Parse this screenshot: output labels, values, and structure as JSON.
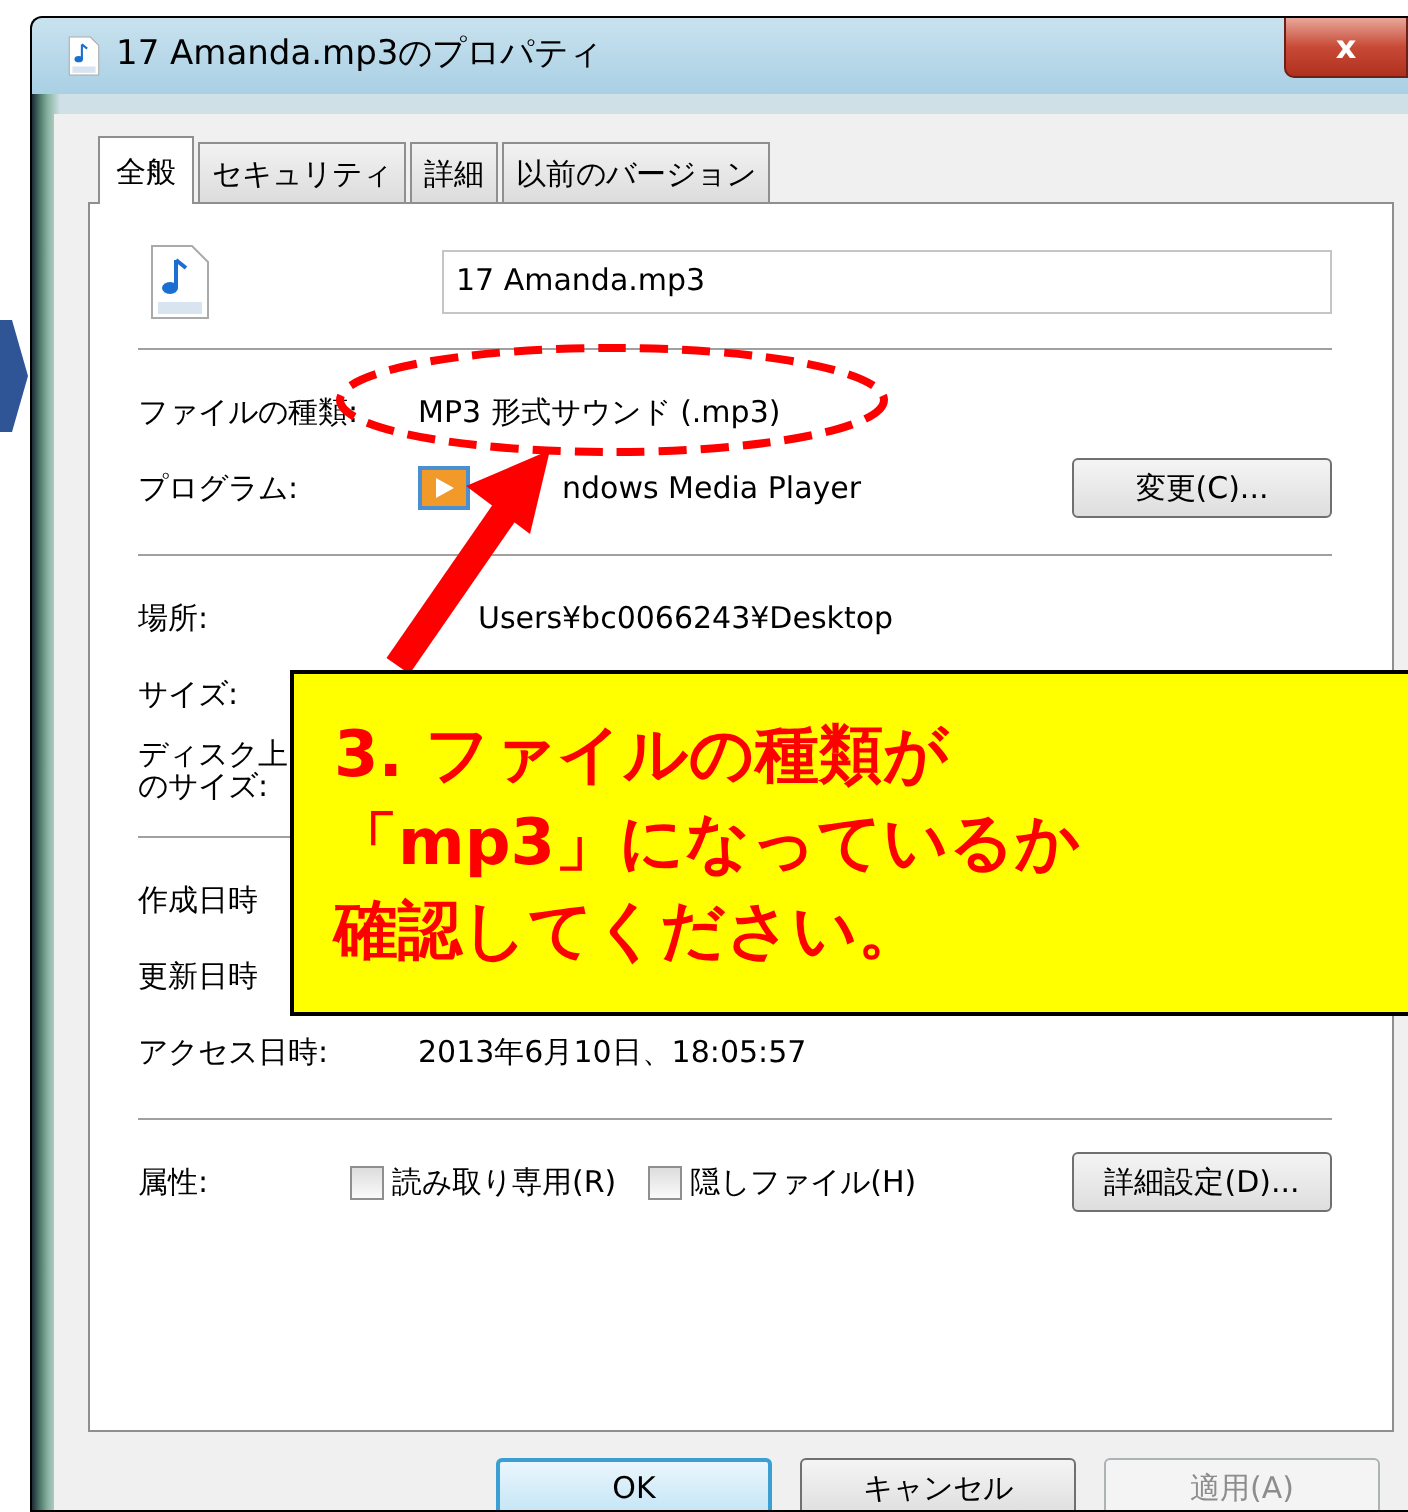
{
  "window": {
    "title": "17 Amanda.mp3のプロパティ",
    "close": "x"
  },
  "tabs": [
    {
      "label": "全般",
      "selected": true
    },
    {
      "label": "セキュリティ",
      "selected": false
    },
    {
      "label": "詳細",
      "selected": false
    },
    {
      "label": "以前のバージョン",
      "selected": false
    }
  ],
  "file_name": "17 Amanda.mp3",
  "sections": [
    [
      {
        "kind": "text",
        "label": "ファイルの種類:",
        "value": "MP3 形式サウンド (.mp3)"
      },
      {
        "kind": "program",
        "label": "プログラム:",
        "value": "ndows Media Player",
        "button": "変更(C)..."
      }
    ],
    [
      {
        "kind": "covered",
        "label": "場所:",
        "value": "Users¥bc0066243¥Desktop"
      },
      {
        "kind": "text",
        "label": "サイズ:"
      },
      {
        "kind": "text",
        "label_lines": [
          "ディスク上",
          "のサイズ:"
        ]
      }
    ],
    [
      {
        "kind": "text",
        "label": "作成日時"
      },
      {
        "kind": "text",
        "label": "更新日時"
      },
      {
        "kind": "text",
        "label": "アクセス日時:",
        "value": "2013年6月10日、18:05:57"
      }
    ]
  ],
  "attributes": {
    "label": "属性:",
    "checkboxes": [
      {
        "label": "読み取り専用(R)",
        "checked": false
      },
      {
        "label": "隠しファイル(H)",
        "checked": false
      }
    ],
    "button": "詳細設定(D)..."
  },
  "buttons": [
    {
      "label": "OK",
      "default": true,
      "disabled": false
    },
    {
      "label": "キャンセル",
      "default": false,
      "disabled": false
    },
    {
      "label": "適用(A)",
      "default": false,
      "disabled": true
    }
  ],
  "callout": {
    "lines": [
      "3. ファイルの種類が",
      "「mp3」になっているか",
      "確認してください。"
    ]
  }
}
